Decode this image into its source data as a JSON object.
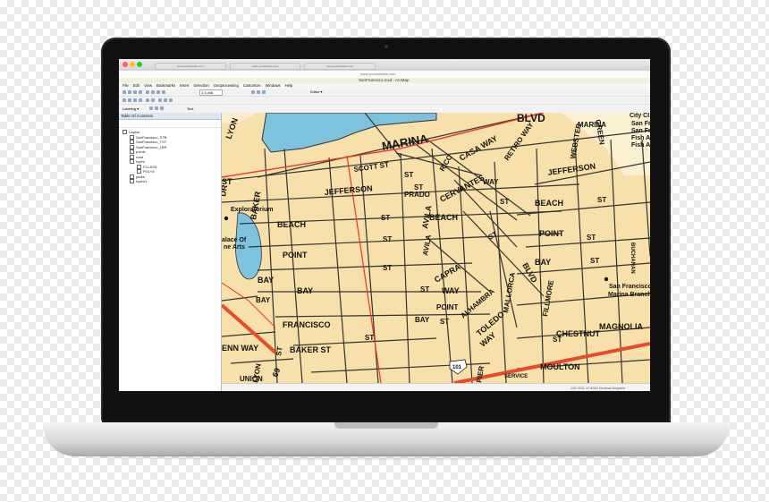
{
  "browser": {
    "tabs": [
      "www.yourwebsite.com",
      "www.yourwebsite.com",
      "www.yourwebsite.com"
    ],
    "url": "www.yourwebsite.com"
  },
  "window": {
    "title": "SanFrancisco.mxd - ArcMap"
  },
  "menubar": [
    "File",
    "Edit",
    "View",
    "Bookmarks",
    "Insert",
    "Selection",
    "Geoprocessing",
    "Customize",
    "Windows",
    "Help"
  ],
  "toolbar": {
    "scale": "1:3,446",
    "editor_label": "Editor ▾",
    "labeling_label": "Labeling ▾",
    "font_name": "Text"
  },
  "toc": {
    "title": "Table Of Contents",
    "items": [
      {
        "label": "Layers",
        "indent": 0
      },
      {
        "label": "SanFrancisco_STB",
        "indent": 1
      },
      {
        "label": "SanFrancisco_TXT",
        "indent": 1
      },
      {
        "label": "SanFrancisco_LBR",
        "indent": 1
      },
      {
        "label": "points",
        "indent": 1
      },
      {
        "label": "road",
        "indent": 1
      },
      {
        "label": "hydro",
        "indent": 1
      },
      {
        "label": "FCLASS",
        "indent": 2
      },
      {
        "label": "POLY4",
        "indent": 2
      },
      {
        "label": "parks",
        "indent": 1
      },
      {
        "label": "hydro1",
        "indent": 1
      }
    ]
  },
  "status": {
    "coords": "-122.4331  37.8024 Decimal Degrees"
  },
  "map": {
    "labels": [
      "BLVD",
      "MARINA",
      "MARINA",
      "GREEN",
      "SCOTT ST",
      "CASA WAY",
      "RICO",
      "RETIRO WAY",
      "ST",
      "WAY",
      "JEFFERSON",
      "ST",
      "JEFFERSON",
      "PRADO",
      "AVILA",
      "CERVANTES",
      "ST",
      "WEBSTER",
      "BEACH",
      "ST",
      "BAKER",
      "BEACH",
      "ST",
      "BEACH",
      "AVILA",
      "POINT",
      "ST",
      "POINT",
      "ST",
      "BAY",
      "ST",
      "CAPRA",
      "WAY",
      "BLVD",
      "BAY",
      "ST",
      "POINT",
      "ST",
      "BAY",
      "ALHAMBRA",
      "MALLORCA",
      "ST",
      "BAY",
      "BAY",
      "FILLMORE",
      "TOLEDO",
      "WAY",
      "ST",
      "FRANCISCO",
      "ST",
      "CHESTNUT",
      "MAGNOLIA",
      "BAKER ST",
      "69",
      "ST",
      "MOULTON",
      "SERVICE",
      "PIER",
      "UNION",
      "LYON",
      "LYON",
      "DR",
      "ST",
      "Exploratorium",
      "alace Of",
      "ne Arts",
      "San Francisco",
      "Marina Branch",
      "City Cl",
      "San Fra",
      "San Fra",
      "Fish Ar",
      "Fish Ar",
      "ENN WAY",
      "101",
      "BUCHANAN",
      "ST"
    ],
    "colors": {
      "land": "#f7e0a9",
      "water": "#7ec3de",
      "street": "#333333",
      "major_road": "#e8362a",
      "highway": "#e84a2a"
    }
  }
}
